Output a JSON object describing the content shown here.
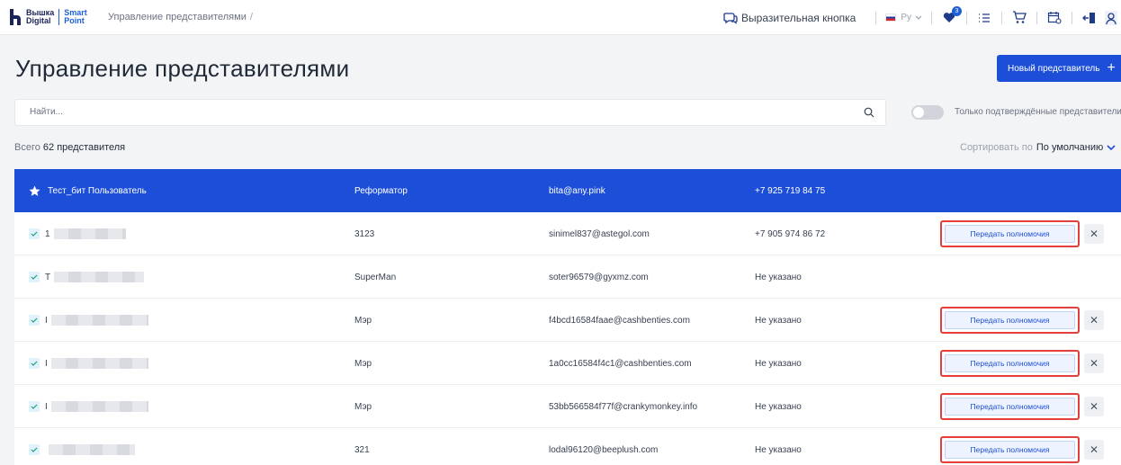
{
  "header": {
    "logo_line1": "Вышка",
    "logo_line1b": "Digital",
    "logo_line2": "Smart",
    "logo_line2b": "Point",
    "breadcrumb": "Управление представителями",
    "breadcrumb_sep": "/",
    "expressive_button": "Выразительная кнопка",
    "language": "Ру",
    "notifications_badge": "3",
    "icons": [
      "chat-bubbles-icon",
      "flag-ru-icon",
      "heart-icon",
      "list-icon",
      "cart-icon",
      "calendar-icon",
      "logout-icon",
      "user-avatar-icon"
    ]
  },
  "page": {
    "title": "Управление представителями",
    "new_button_label": "Новый представитель",
    "new_button_icon": "plus-icon",
    "search_placeholder": "Найти...",
    "search_value": "",
    "toggle_label": "Только подтверждённые представители",
    "toggle_on": false,
    "count_prefix": "Всего",
    "count_value": "62 представителя",
    "sort_prefix": "Сортировать по",
    "sort_value": "По умолчанию"
  },
  "table": {
    "header_row": {
      "name": "Тест_бит Пользователь",
      "role": "Реформатор",
      "email": "bita@any.pink",
      "phone": "+7 925 719 84 75"
    },
    "action_label": "Передать полномочия",
    "rows": [
      {
        "name_first": "1",
        "role": "3123",
        "email": "sinimel837@astegol.com",
        "phone": "+7 905 974 86 72",
        "has_action": true
      },
      {
        "name_first": "T",
        "role": "SuperMan",
        "email": "soter96579@gyxmz.com",
        "phone": "Не указано",
        "has_action": false
      },
      {
        "name_first": "I",
        "role": "Мэр",
        "email": "f4bcd16584faae@cashbenties.com",
        "phone": "Не указано",
        "has_action": true
      },
      {
        "name_first": "I",
        "role": "Мэр",
        "email": "1a0cc16584f4c1@cashbenties.com",
        "phone": "Не указано",
        "has_action": true
      },
      {
        "name_first": "I",
        "role": "Мэр",
        "email": "53bb566584f77f@crankymonkey.info",
        "phone": "Не указано",
        "has_action": true
      },
      {
        "name_first": "",
        "role": "321",
        "email": "lodal96120@beeplush.com",
        "phone": "Не указано",
        "has_action": true
      }
    ]
  },
  "colors": {
    "accent": "#1d4ed8",
    "highlight_border": "#e53e3e",
    "background": "#f3f4f6"
  }
}
